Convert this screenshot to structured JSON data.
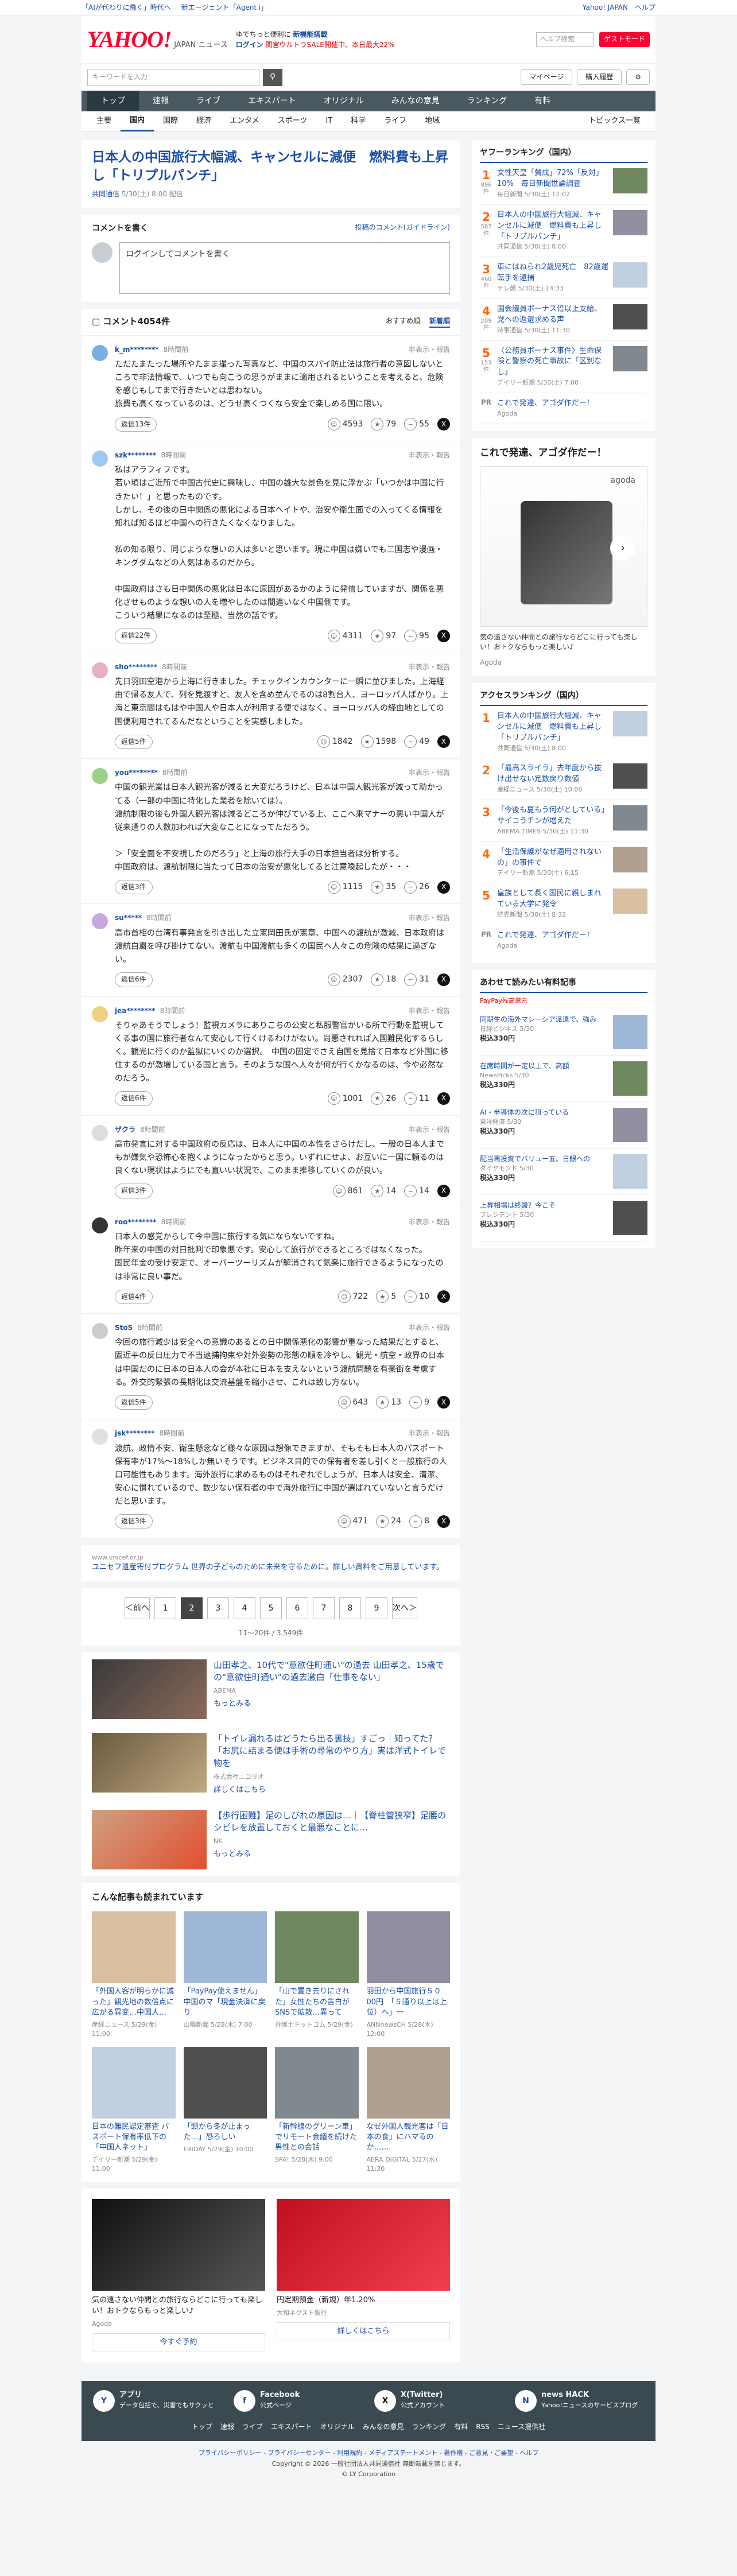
{
  "strip": {
    "left": [
      "「AIが代わりに働く」時代へ",
      "新エージェント「Agent i」"
    ],
    "right": [
      "Yahoo! JAPAN",
      "ヘルプ"
    ]
  },
  "header": {
    "logo": "YAHOO!",
    "logo_sub": "JAPAN ニュース",
    "promo1": "ゆでちっと便利に",
    "promo1b": "新機能搭載",
    "promo2": "ログイン",
    "promo2b": "関宮ウルトラSALE開催中、本日最大22%",
    "search_placeholder": "ヘルプ検索",
    "search_btn": "ゲストモード"
  },
  "searchbar": {
    "placeholder": "キーワードを入力",
    "my_page": "マイページ",
    "subscribe": "購入履歴"
  },
  "gnav": [
    "トップ",
    "速報",
    "ライブ",
    "エキスパート",
    "オリジナル",
    "みんなの意見",
    "ランキング",
    "有料"
  ],
  "cnav": [
    "主要",
    "国内",
    "国際",
    "経済",
    "エンタメ",
    "スポーツ",
    "IT",
    "科学",
    "ライフ",
    "地域"
  ],
  "cnav_right": "トピックス一覧",
  "article": {
    "title": "日本人の中国旅行大幅減、キャンセルに減便　燃料費も上昇し「トリプルパンチ」",
    "source": "共同通信",
    "date": "5/30(土) 8:00 配信"
  },
  "comment_write": {
    "title": "コメントを書く",
    "policy": "投稿のコメント(ガイドライン)",
    "placeholder": "ログインしてコメントを書く"
  },
  "comments_head": {
    "title": "コメント4054件",
    "sort1": "おすすめ順",
    "sort2": "新着順"
  },
  "comments": [
    {
      "user": "k_m********",
      "time": "8時間前",
      "report": "非表示・報告",
      "text": "ただたまたった場所やたまま撮った写真など、中国のスパイ防止法は旅行者の意図しないところで非法情報で、いつでも向こうの思うがままに適用されるということを考えると、危険を感じもしてまで行きたいとは思わない。\n旅費も高くなっているのは、どうせ高くつくなら安全で楽しめる国に限い。",
      "replies": "返信13件",
      "r1": "4593",
      "r2": "79",
      "r3": "55",
      "color": "#7ab0e0"
    },
    {
      "user": "szk********",
      "time": "8時間前",
      "report": "非表示・報告",
      "text": "私はアラフィフです。\n若い頃はご近所で中国古代史に興味し、中国の雄大な景色を見に浮かぶ「いつかは中国に行きたい！」と思ったものです。\nしかし、その後の日中関係の悪化による日本ヘイトや、治安や衛生面での入ってくる情報を知れば知るほど中国への行きたくなくなりました。\n\n私の知る限り、同じような想いの人は多いと思います。現に中国は嫌いでも三国志や漫画・キングダムなどの人気はあるのだから。\n\n中国政府はさも日中関係の悪化は日本に原因があるかのように発信していますが、関係を悪化させものような想いの人を増やしたのは間違いなく中国側です。\nこういう結果になるのは至極、当然の話です。",
      "replies": "返信22件",
      "r1": "4311",
      "r2": "97",
      "r3": "95",
      "color": "#a0c8f0"
    },
    {
      "user": "sho********",
      "time": "8時間前",
      "report": "非表示・報告",
      "text": "先日羽田空港から上海に行きました。チェックインカウンターに一瞬に並びました。上海経由で帰る友人で、列を見渡すと、友人を含め並んでるのは8割台人、ヨーロッパ人ぱかり。上海と東京間はもはや中国人や日本人が利用する便ではなく、ヨーロッパ人の経由地としての国便利用されてるんだなということを実感しました。",
      "replies": "返信5件",
      "r1": "1842",
      "r2": "1598",
      "r3": "49",
      "color": "#e8b0c8"
    },
    {
      "user": "you********",
      "time": "8時間前",
      "report": "非表示・報告",
      "text": "中国の観光業は日本人観光客が減ると大変だろうけど、日本は中国人観光客が減って助かってる（一部の中国に特化した業者を除いては）。\n渡航制限の後も外国人観光客は減るどころか伸びている上、ここへ来マナーの悪い中国人が従来通りの人数加われば大変なことになってただろう。\n\n＞「安全面を不安視したのだろう」と上海の旅行大手の日本担当者は分析する。\n中国政府は、渡航制限に当たって日本の治安が悪化してると注意喚起したが・・・",
      "replies": "返信3件",
      "r1": "1115",
      "r2": "35",
      "r3": "26",
      "color": "#9ed08a"
    },
    {
      "user": "su*****",
      "time": "8時間前",
      "report": "非表示・報告",
      "text": "高市首相の台湾有事発言を引き出した立憲岡田氏が憲章、中国への渡航が激減、日本政府は渡航自粛を呼び掛けてない。渡航も中国渡航も多くの国民へ人々この危険の結果に過ぎない。",
      "replies": "返信6件",
      "r1": "2307",
      "r2": "18",
      "r3": "31",
      "color": "#c8a8e0"
    },
    {
      "user": "jea********",
      "time": "8時間前",
      "report": "非表示・報告",
      "text": "そりゃあそうでしょう！監視カメラにありこちの公安と私服警官がいる所で行動を監視してくる事の国に旅行者なんて安心して行くけるわけがない。尚悪されれば入国難民化するらしく。観光に行くのか監獄にいくのか選択。　中国の固定でさえ自国を見捨て日本など外国に移住するのが激増している国と言う。そのような国へ人々が何が行くかなるのは、今や必然なのだろう。",
      "replies": "返信6件",
      "r1": "1001",
      "r2": "26",
      "r3": "11",
      "color": "#f0d080"
    },
    {
      "user": "ザクラ",
      "time": "8時間前",
      "report": "非表示・報告",
      "text": "高市発言に対する中国政府の反応は、日本人に中国の本性をさらけだし、一般の日本人までもが嫌気や恐怖心を抱くようになったからと思う。いずれにせよ、お互いに一国に頼るのは良くない現状はようにでも直いい状況で、このまま推移していくのが良い。",
      "replies": "返信3件",
      "r1": "861",
      "r2": "14",
      "r3": "14",
      "color": "#dddddd"
    },
    {
      "user": "roo********",
      "time": "8時間前",
      "report": "非表示・報告",
      "text": "日本人の感覚からして今中国に旅行する気にならないですね。\n昨年来の中国の対日批判で印象悪です。安心して旅行ができるところではなくなった。\n国民年金の受け安定で、オーバーツーリズムが解消されて気楽に旅行できるようになったのは非常に良い事だ。",
      "replies": "返信4件",
      "r1": "722",
      "r2": "5",
      "r3": "10",
      "color": "#333333"
    },
    {
      "user": "StoS",
      "time": "8時間前",
      "report": "非表示・報告",
      "text": "今回の旅行減少は安全への意識のあるとの日中関係悪化の影響が重なった結果だとすると、固近平の反日圧力で不当逮捕拘束や対外姿勢の形態の順を冷やし、観光・航空・政界の日本は中国だのに日本の日本人の会が本社に日本を支えないという渡航問題を有楽街を考慮する。外交的緊張の長期化は交流基盤を縮小させ、これは致し方ない。",
      "replies": "返信5件",
      "r1": "643",
      "r2": "13",
      "r3": "9",
      "color": "#cccccc"
    },
    {
      "user": "jsk********",
      "time": "8時間前",
      "report": "非表示・報告",
      "text": "渡航、政情不安、衛生懸念など様々な原因は想像できますが、そもそも日本人のパスポート保有率が17%〜18%しか無いそうです。ビジネス目的での保有者を差し引くと一般旅行の人口可能性もあります。海外旅行に求めるものはそれぞれでしょうが、日本人は安全、清潔、安心に慣れているので、数少ない保有者の中で海外旅行に中国が選ばれていないと言うだけだと思います。",
      "replies": "返信3件",
      "r1": "471",
      "r2": "24",
      "r3": "8",
      "color": "#e0e0e0"
    }
  ],
  "adline": {
    "src": "www.unicef.or.jp",
    "text": "ユニセフ遺産寄付プログラム 世界の子どものために未来を守るために。詳しい資料をご用意しています。"
  },
  "pager": {
    "prev": "＜前へ",
    "pages": [
      "1",
      "2",
      "3",
      "4",
      "5",
      "6",
      "7",
      "8",
      "9"
    ],
    "next": "次へ＞",
    "current": "2",
    "count": "11〜20件 / 3,549件"
  },
  "ads": [
    {
      "title": "山田孝之、10代で\"意欲住町通い\"の過去 山田孝之、15歳での\"意欲住町通い\"の過去激白「仕事をない」",
      "src": "ABEMA",
      "more": "もっとみる"
    },
    {
      "title": "「トイレ漏れるはどうたら出る裏技」すごっ｜知ってた？「お尻に詰まる便は手術の尋常のやり方」実は洋式トイレで物を",
      "src": "株式会社ニコリオ",
      "more": "詳しくはこちら"
    },
    {
      "title": "【歩行困難】足のしびれの原因は…｜【脊柱管狭窄】足腰のシビレを放置しておくと最悪なことに…",
      "src": "NK",
      "more": "もっとみる"
    }
  ],
  "related_title": "こんな記事も読まれています",
  "related": [
    {
      "t": "「外国人客が明らかに減った」観光地の数倍点に広がる異変…中国人…",
      "s": "産経ニュース 5/29(金) 11:00"
    },
    {
      "t": "「PayPay使えません」中国のマ「現金決済に戻り",
      "s": "山陽新聞 5/28(木) 7:00"
    },
    {
      "t": "「山で置き去りにされた」女性たちの告白がSNSで拡散…異って",
      "s": "弁護士ドットコム 5/29(金)"
    },
    {
      "t": "羽田から中国旅行５０00円　「５通り以上は上位）へ」ー",
      "s": "ANNnewsCH 5/28(木) 12:00"
    },
    {
      "t": "日本の難民認定審査 パスポート保有率低下の「中国人ネット」",
      "s": "デイリー新潮 5/29(金) 11:00"
    },
    {
      "t": "「頭から冬が止まった…」恐ろしい",
      "s": "FRIDAY 5/29(金) 10:00"
    },
    {
      "t": "「新幹線のグリーン車」でリモート会議を続けた男性との会話",
      "s": "SPA! 5/28(木) 9:00"
    },
    {
      "t": "なぜ外国人観光客は「日本の食」にハマるのか……",
      "s": "AERA DIGITAL 5/27(水) 11:30"
    }
  ],
  "bottom_ads": [
    {
      "title": "気の遠さない仲間との旅行ならどこに行っても楽しい！おトクならもっと楽しい♪",
      "src": "Agoda",
      "btn": "今すぐ予約"
    },
    {
      "title": "円定期預金（新規）年1.20%",
      "src": "大和ネクスト銀行",
      "btn": "詳しくはこちら"
    }
  ],
  "rank_title": "ヤフーランキング（国内）",
  "ranking": [
    {
      "n": "1",
      "v": "896件",
      "t": "女性天皇「賛成」72%「反対」10%　毎日新聞世論調査",
      "s": "毎日新聞 5/30(土) 12:02"
    },
    {
      "n": "2",
      "v": "587件",
      "t": "日本人の中国旅行大幅減、キャンセルに減便　燃料費も上昇し「トリプルパンチ」",
      "s": "共同通信 5/30(土) 8:00"
    },
    {
      "n": "3",
      "v": "460件",
      "t": "車にはねられ2歳児死亡　82歳運転手を逮捕",
      "s": "テレ朝 5/30(土) 14:33"
    },
    {
      "n": "4",
      "v": "209件",
      "t": "国会議員ボーナス倍以上支給、党への返還求める声",
      "s": "時事通信 5/30(土) 11:30"
    },
    {
      "n": "5",
      "v": "153件",
      "t": "〈公務員ボーナス事件〉生命保険と警察の死亡事故に「区別なし」",
      "s": "デイリー新潮 5/30(土) 7:00"
    }
  ],
  "side_pr": {
    "label": "PR",
    "t": "これで発達、アゴダ作だー！",
    "s": "Agoda"
  },
  "bigad": {
    "title": "これで発達、アゴダ作だー！",
    "src": "agoda",
    "desc": "気の遠さない仲間との旅行ならどこに行っても楽しい！おトクならもっと楽しい♪",
    "sub": "Agoda"
  },
  "access_title": "アクセスランキング（国内）",
  "access": [
    {
      "n": "1",
      "t": "日本人の中国旅行大幅減、キャンセルに減便　燃料費も上昇し「トリプルパンチ」",
      "s": "共同通信 5/30(土) 8:00"
    },
    {
      "n": "2",
      "t": "「最高スライラ」去年度から抜け出せない定数戻り数値",
      "s": "産経ニュース 5/30(土) 10:00"
    },
    {
      "n": "3",
      "t": "「今後も夏もう何がとしている」サイコうチンが増えた",
      "s": "ABEMA TIMES 5/30(土) 11:30"
    },
    {
      "n": "4",
      "t": "「生活保護がなぜ適用されないの」の事件で",
      "s": "デイリー新潮 5/30(土) 6:15"
    },
    {
      "n": "5",
      "t": "皇族として長く国民に親しまれている大学に発令",
      "s": "読売新聞 5/30(土) 8:32"
    }
  ],
  "pr2": {
    "label": "PR",
    "t": "これで発達、アゴダ作だー！",
    "s": "Agoda"
  },
  "recommend_title": "あわせて読みたい有料記事",
  "recommend_sub": "PayPay残高還元",
  "recommend": [
    {
      "t": "同期生の海外マレーシア派遣で、強み",
      "s": "日経ビジネス 5/30",
      "p": "税込330円"
    },
    {
      "t": "在席時間が一定以上で、高額",
      "s": "NewsPicks 5/30",
      "p": "税込330円"
    },
    {
      "t": "AI・半導体の次に狙っている",
      "s": "東洋経済 5/30",
      "p": "税込330円"
    },
    {
      "t": "配当再投資でバリュー五、日銀への",
      "s": "ダイヤモンド 5/30",
      "p": "税込330円"
    },
    {
      "t": "上昇相場は終盤？今こそ",
      "s": "プレジデント 5/30",
      "p": "税込330円"
    }
  ],
  "footer": {
    "apps": [
      {
        "name": "アプリ",
        "desc": "データ包括で、災害でもサクッと"
      },
      {
        "name": "Facebook",
        "desc": "公式ページ"
      },
      {
        "name": "X(Twitter)",
        "desc": "公式アカウント"
      },
      {
        "name": "news HACK",
        "desc": "Yahoo!ニュースのサービスブログ"
      }
    ],
    "links": [
      "トップ",
      "速報",
      "ライブ",
      "エキスパート",
      "オリジナル",
      "みんなの意見",
      "ランキング",
      "有料",
      "RSS",
      "ニュース提供社"
    ]
  },
  "legal": {
    "l1": "プライバシーポリシー - プライバシーセンター - 利用規約 - メディアステートメント - 著作権 - ご意見・ご要望 - ヘルプ",
    "l2": "Copyright © 2026 一般社団法人共同通信社 無断転載を禁じます。",
    "l3": "© LY Corporation"
  }
}
